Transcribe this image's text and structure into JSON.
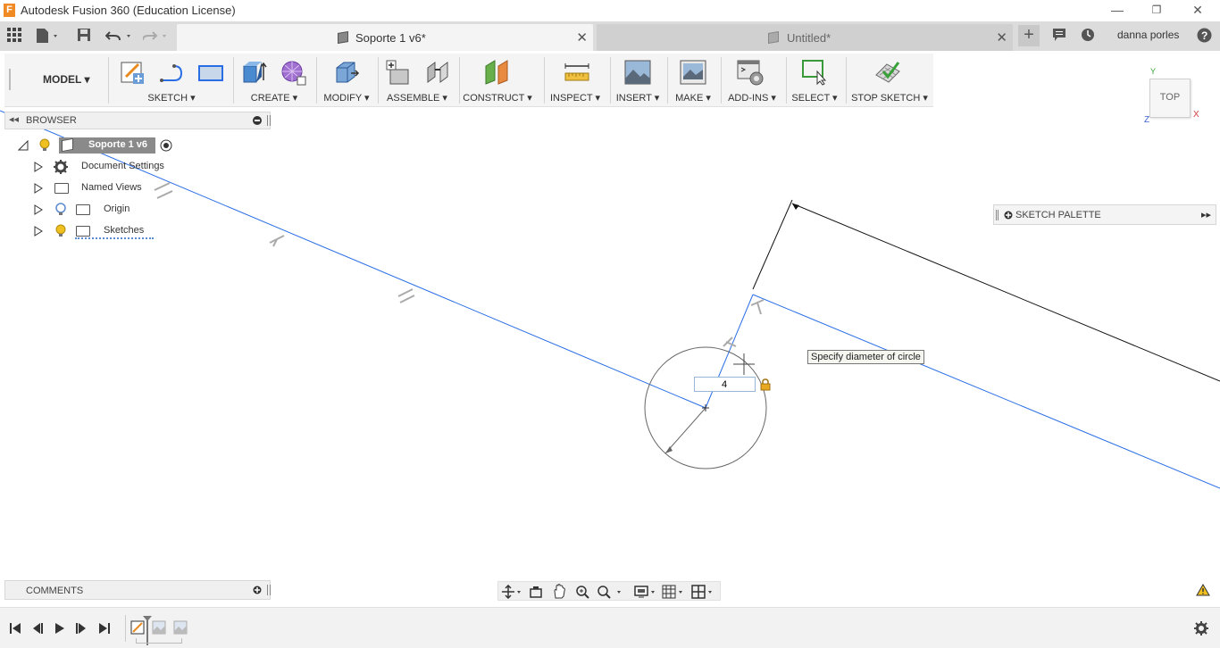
{
  "window": {
    "title": "Autodesk Fusion 360 (Education License)",
    "logo_letter": "F",
    "minimize": "—",
    "restore": "❐",
    "close": "✕"
  },
  "tabs": [
    {
      "label": "Soporte 1 v6*",
      "active": true
    },
    {
      "label": "Untitled*",
      "active": false
    }
  ],
  "user": {
    "name": "danna porles"
  },
  "toolbar": {
    "workspace": "MODEL ▾",
    "groups": [
      {
        "label": "SKETCH ▾"
      },
      {
        "label": "CREATE ▾"
      },
      {
        "label": "MODIFY ▾"
      },
      {
        "label": "ASSEMBLE ▾"
      },
      {
        "label": "CONSTRUCT ▾"
      },
      {
        "label": "INSPECT ▾"
      },
      {
        "label": "INSERT ▾"
      },
      {
        "label": "MAKE ▾"
      },
      {
        "label": "ADD-INS ▾"
      },
      {
        "label": "SELECT ▾"
      },
      {
        "label": "STOP SKETCH ▾"
      }
    ]
  },
  "browser": {
    "title": "BROWSER",
    "root": "Soporte 1 v6",
    "items": [
      {
        "label": "Document Settings"
      },
      {
        "label": "Named Views"
      },
      {
        "label": "Origin"
      },
      {
        "label": "Sketches"
      }
    ]
  },
  "sketch_palette": {
    "title": "SKETCH PALETTE"
  },
  "tooltip": {
    "text": "Specify diameter of circle"
  },
  "dimension_input": {
    "value": "4"
  },
  "comments": {
    "title": "COMMENTS"
  },
  "viewcube": {
    "face": "TOP",
    "axis_x": "X",
    "axis_y": "Y",
    "axis_z": "Z"
  },
  "colors": {
    "sketch_line": "#2a6ee6",
    "accent": "#f08a24"
  }
}
